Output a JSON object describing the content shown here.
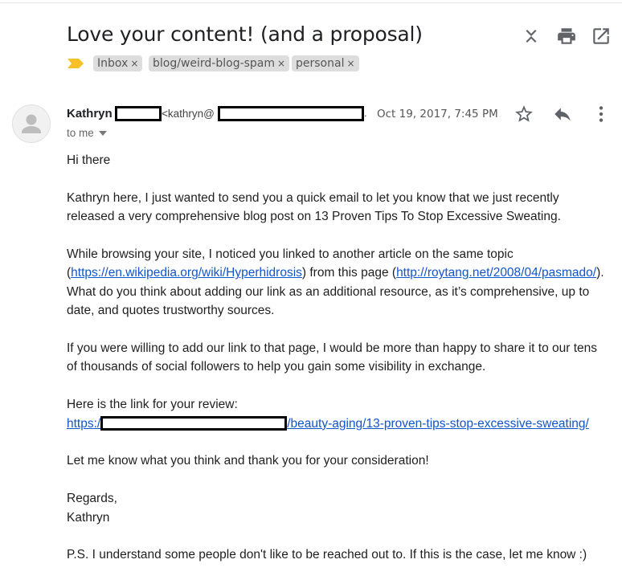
{
  "email": {
    "subject": "Love your content! (and a proposal)",
    "labels": [
      "Inbox",
      "blog/weird-blog-spam",
      "personal"
    ],
    "label_remove_glyph": "×",
    "sender": {
      "name": "Kathryn",
      "email_prefix": "<kathryn@",
      "email_suffix": ".",
      "date": "Oct 19, 2017, 7:45 PM"
    },
    "recipient": "to me",
    "body": {
      "greeting": "Hi there",
      "p1_line1": "Kathryn here, I just wanted to send you a quick email to let you know that we just recently",
      "p1_line2": "released a very comprehensive blog post on 13 Proven Tips To Stop Excessive Sweating.",
      "p2_line1": "While browsing your site, I noticed you linked to another article on the same topic",
      "p2_line2_a": "(",
      "p2_link1": "https://en.wikipedia.org/wiki/Hyperhidrosis",
      "p2_line2_b": ") from this page (",
      "p2_link2": "http://roytang.net/2008/04/pasmado/",
      "p2_line2_c": ").",
      "p2_line3": "What do you think about adding our link as an additional resource, as it’s comprehensive, up to",
      "p2_line4": "date, and quotes trustworthy sources.",
      "p3_line1": "If you were willing to add our link to that page, I would be more than happy to share it to our tens",
      "p3_line2": "of thousands of social followers to help you gain some visibility in exchange.",
      "p4_line1": "Here is the link for your review:",
      "p4_link_prefix": "https:/",
      "p4_link_suffix": "/beauty-aging/13-proven-tips-stop-excessive-sweating/",
      "p5": "Let me know what you think and thank you for your consideration!",
      "sign1": "Regards,",
      "sign2": "Kathryn",
      "ps": "P.S. I understand some people don't like to be reached out to. If this is the case, let me know :)"
    }
  },
  "icons": {
    "header": [
      "collapse-icon",
      "print-icon",
      "open-in-new-window-icon"
    ],
    "actions": [
      "star-icon",
      "reply-icon",
      "more-vert-icon"
    ],
    "importance": "important-marker-icon",
    "avatar": "person-icon",
    "recipient_caret": "caret-down-icon"
  },
  "colors": {
    "link": "#1155cc",
    "importance_marker": "#f6c026",
    "label_chip_bg": "#dddddd",
    "icon_gray": "#5f6368"
  }
}
